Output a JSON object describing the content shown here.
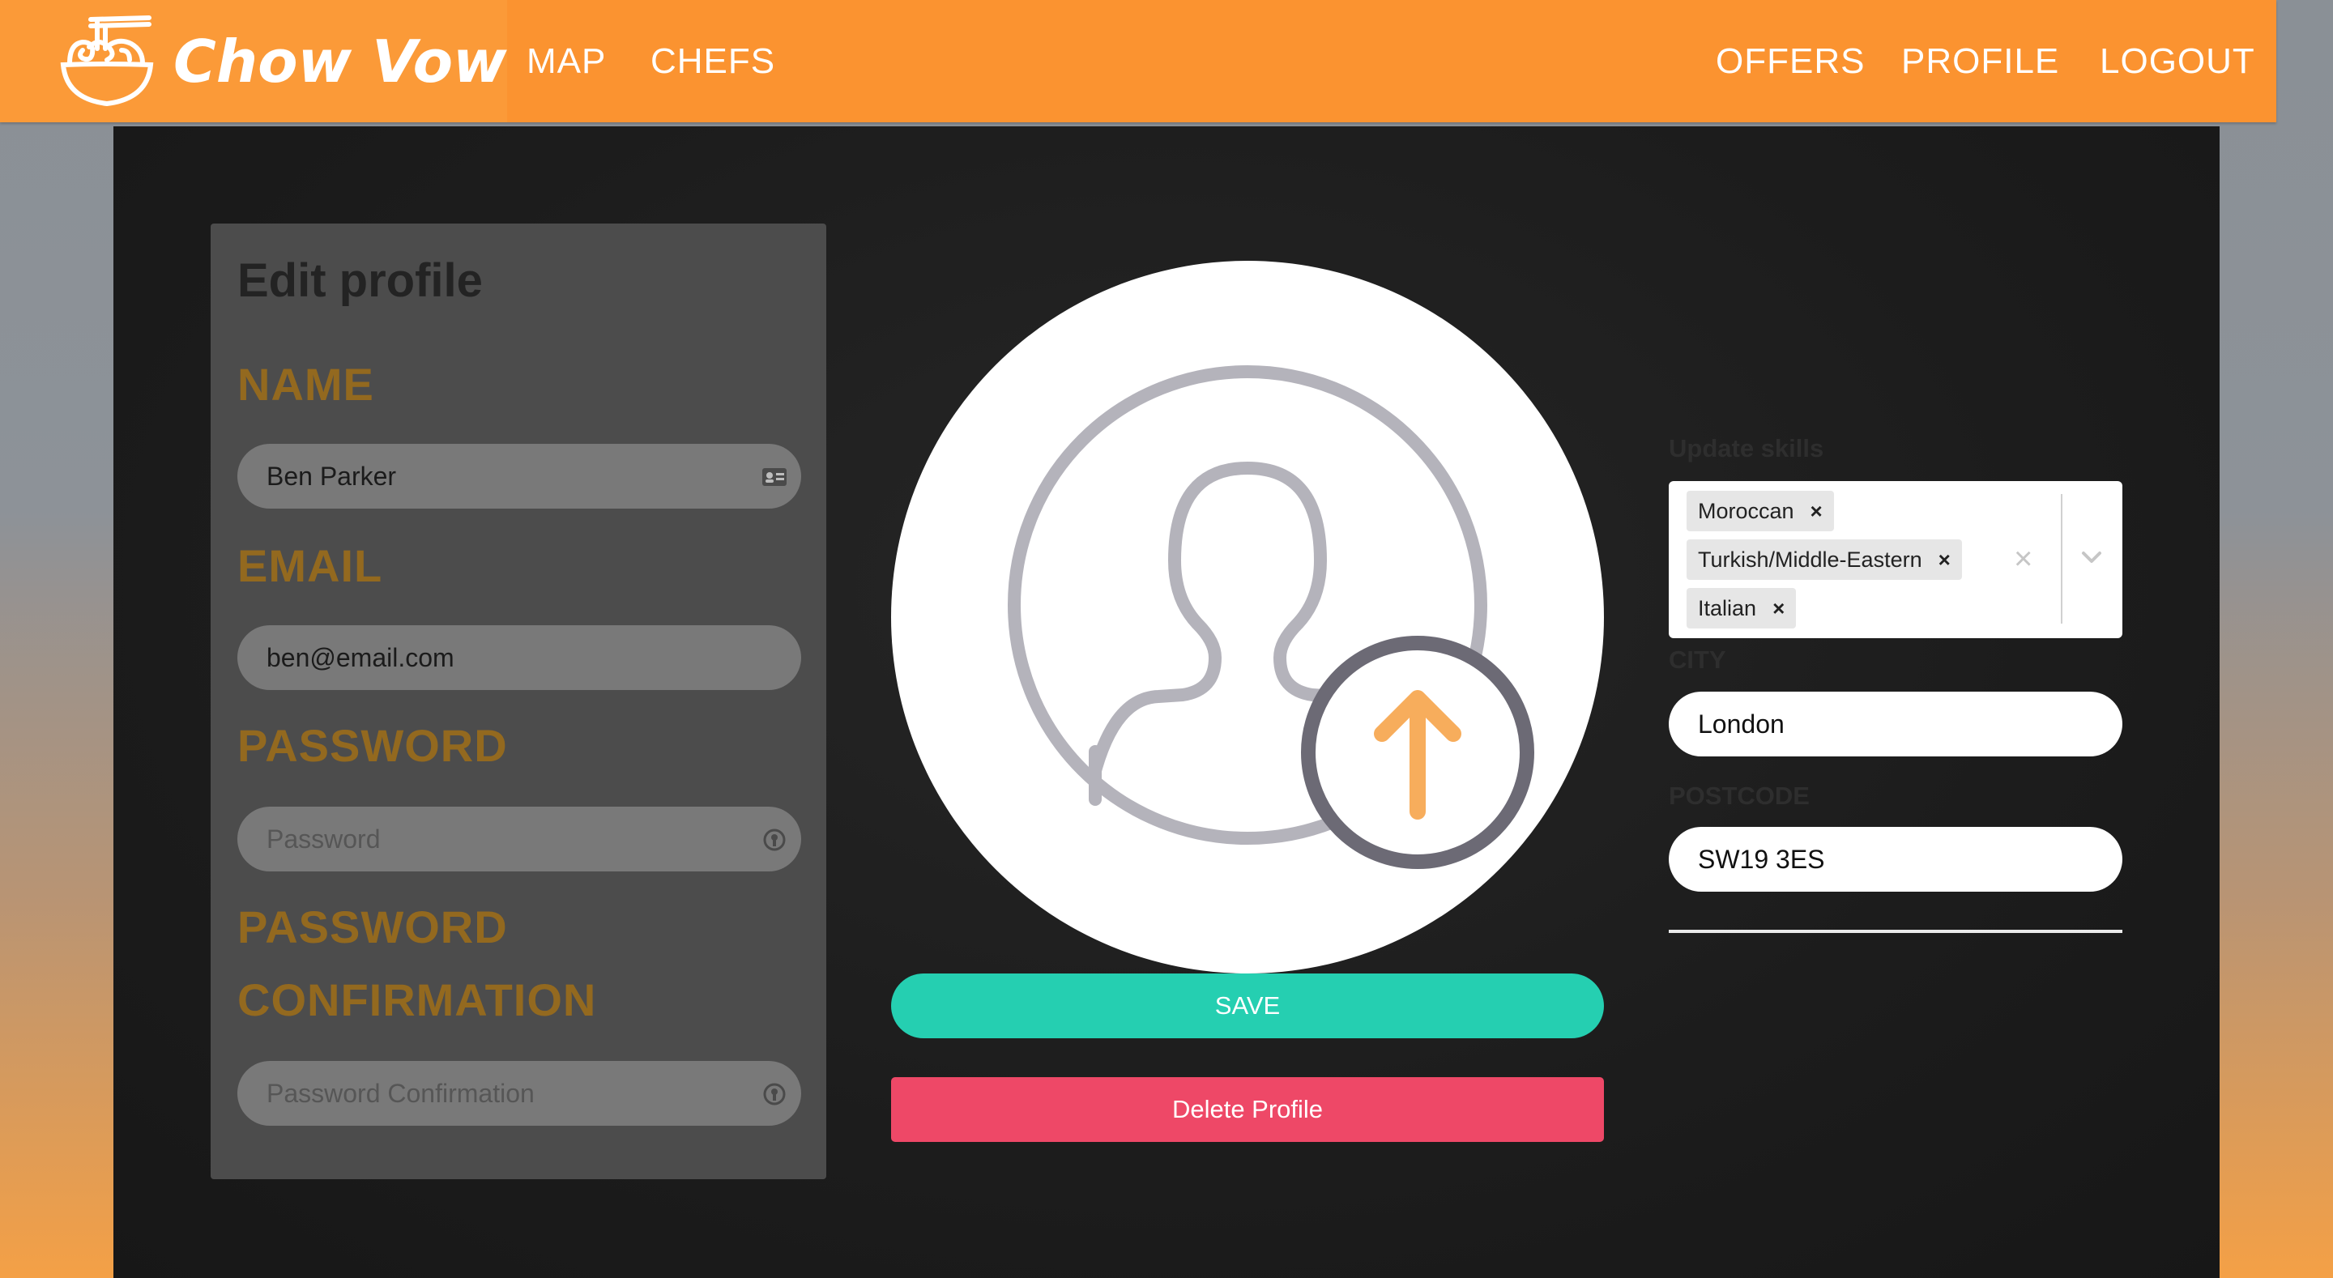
{
  "nav": {
    "brand": "Chow Vow",
    "left_links": [
      "MAP",
      "CHEFS"
    ],
    "right_links": [
      "OFFERS",
      "PROFILE",
      "LOGOUT"
    ]
  },
  "form": {
    "title": "Edit profile",
    "name_label": "NAME",
    "name_value": "Ben Parker",
    "email_label": "EMAIL",
    "email_value": "ben@email.com",
    "password_label": "PASSWORD",
    "password_placeholder": "Password",
    "confirm_label_1": "PASSWORD",
    "confirm_label_2": "CONFIRMATION",
    "confirm_placeholder": "Password Confirmation"
  },
  "avatar": {
    "save_label": "SAVE",
    "delete_label": "Delete Profile"
  },
  "right": {
    "skills_label": "Update skills",
    "skills": [
      "Moroccan",
      "Turkish/Middle-Eastern",
      "Italian"
    ],
    "city_label": "CITY",
    "city_value": "London",
    "postcode_label": "POSTCODE",
    "postcode_value": "SW19 3ES"
  },
  "colors": {
    "navbar": "#fb9330",
    "label": "#93691f",
    "save": "#25cfb1",
    "delete": "#ee4867",
    "upload_arrow": "#f7ad5c"
  },
  "icons": {
    "brand": "noodle-bowl-icon",
    "name_field": "id-card-icon",
    "password_field": "key-icon",
    "upload": "upload-arrow-icon",
    "avatar": "user-silhouette-icon"
  }
}
